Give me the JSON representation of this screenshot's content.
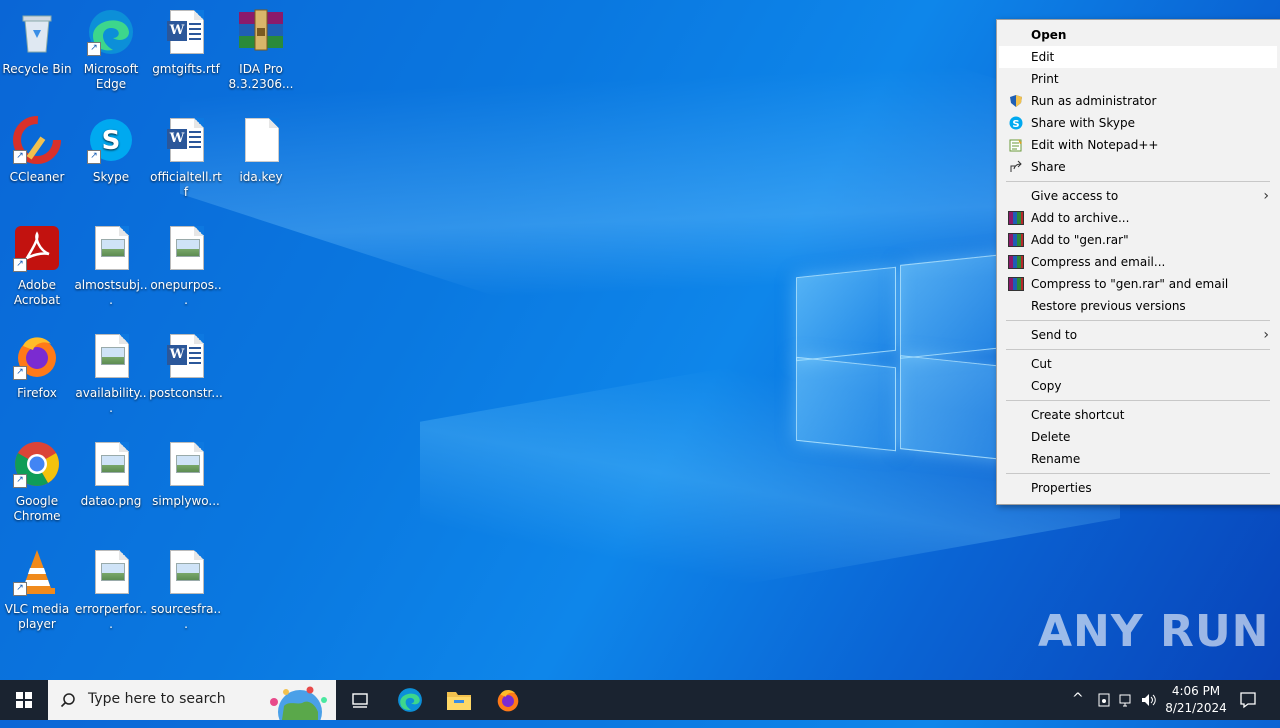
{
  "desktop": {
    "icons": [
      {
        "label": "Recycle Bin"
      },
      {
        "label": "Microsoft Edge"
      },
      {
        "label": "gmtgifts.rtf"
      },
      {
        "label": "IDA Pro 8.3.2306..."
      },
      {
        "label": "CCleaner"
      },
      {
        "label": "Skype"
      },
      {
        "label": "officialtell.rtf"
      },
      {
        "label": "ida.key"
      },
      {
        "label": "Adobe Acrobat"
      },
      {
        "label": "almostsubj..."
      },
      {
        "label": "onepurpos..."
      },
      {
        "label": "Firefox"
      },
      {
        "label": "availability..."
      },
      {
        "label": "postconstr..."
      },
      {
        "label": "Google Chrome"
      },
      {
        "label": "datao.png"
      },
      {
        "label": "simplywo..."
      },
      {
        "label": "VLC media player"
      },
      {
        "label": "errorperfor..."
      },
      {
        "label": "sourcesfra..."
      }
    ],
    "watermark": "ANY RUN"
  },
  "context_menu": {
    "items": [
      {
        "label": "Open"
      },
      {
        "label": "Edit"
      },
      {
        "label": "Print"
      },
      {
        "label": "Run as administrator"
      },
      {
        "label": "Share with Skype"
      },
      {
        "label": "Edit with Notepad++"
      },
      {
        "label": "Share"
      },
      {
        "label": "Give access to"
      },
      {
        "label": "Add to archive..."
      },
      {
        "label": "Add to \"gen.rar\""
      },
      {
        "label": "Compress and email..."
      },
      {
        "label": "Compress to \"gen.rar\" and email"
      },
      {
        "label": "Restore previous versions"
      },
      {
        "label": "Send to"
      },
      {
        "label": "Cut"
      },
      {
        "label": "Copy"
      },
      {
        "label": "Create shortcut"
      },
      {
        "label": "Delete"
      },
      {
        "label": "Rename"
      },
      {
        "label": "Properties"
      }
    ]
  },
  "taskbar": {
    "search_placeholder": "Type here to search",
    "time": "4:06 PM",
    "date": "8/21/2024"
  },
  "colors": {
    "accent": "#0078d7",
    "taskbar_bg": "#1a2330",
    "menu_bg": "#f2f2f2"
  }
}
